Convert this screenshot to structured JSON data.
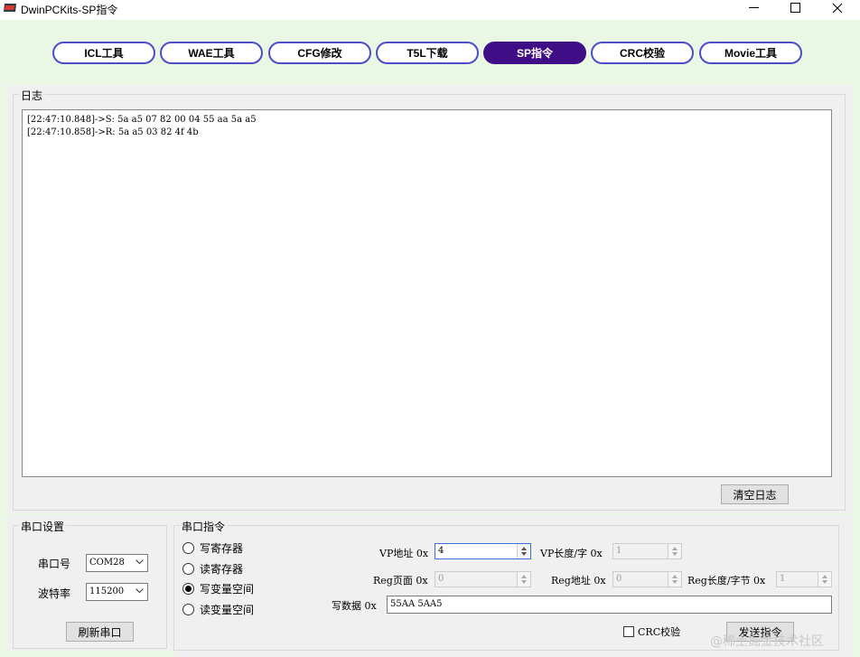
{
  "window": {
    "title": "DwinPCKits-SP指令",
    "controls": [
      "minimize-icon",
      "maximize-icon",
      "close-icon"
    ]
  },
  "tabs": [
    {
      "label": "ICL工具",
      "active": false
    },
    {
      "label": "WAE工具",
      "active": false
    },
    {
      "label": "CFG修改",
      "active": false
    },
    {
      "label": "T5L下载",
      "active": false
    },
    {
      "label": "SP指令",
      "active": true
    },
    {
      "label": "CRC校验",
      "active": false
    },
    {
      "label": "Movie工具",
      "active": false
    }
  ],
  "log": {
    "title": "日志",
    "lines": [
      "[22:47:10.848]->S: 5a a5 07 82 00 04 55 aa 5a a5",
      "[22:47:10.858]->R: 5a a5 03 82 4f 4b"
    ],
    "clear_label": "清空日志"
  },
  "serial": {
    "title": "串口设置",
    "port_label": "串口号",
    "port_value": "COM28",
    "baud_label": "波特率",
    "baud_value": "115200",
    "refresh_label": "刷新串口"
  },
  "command": {
    "title": "串口指令",
    "radios": [
      {
        "label": "写寄存器",
        "checked": false
      },
      {
        "label": "读寄存器",
        "checked": false
      },
      {
        "label": "写变量空间",
        "checked": true
      },
      {
        "label": "读变量空间",
        "checked": false
      }
    ],
    "vp_addr_label": "VP地址 0x",
    "vp_addr_value": "4",
    "vp_len_label": "VP长度/字 0x",
    "vp_len_value": "1",
    "reg_page_label": "Reg页面 0x",
    "reg_page_value": "0",
    "reg_addr_label": "Reg地址 0x",
    "reg_addr_value": "0",
    "reg_len_label": "Reg长度/字节 0x",
    "reg_len_value": "1",
    "write_data_label": "写数据 0x",
    "write_data_value": "55AA 5AA5",
    "crc_label": "CRC校验",
    "crc_checked": false,
    "send_label": "发送指令"
  },
  "watermark": "@稀土掘金技术社区",
  "colors": {
    "background": "#eaf7e4",
    "tab_border": "#4d4dc8",
    "tab_active": "#3f0e86"
  }
}
